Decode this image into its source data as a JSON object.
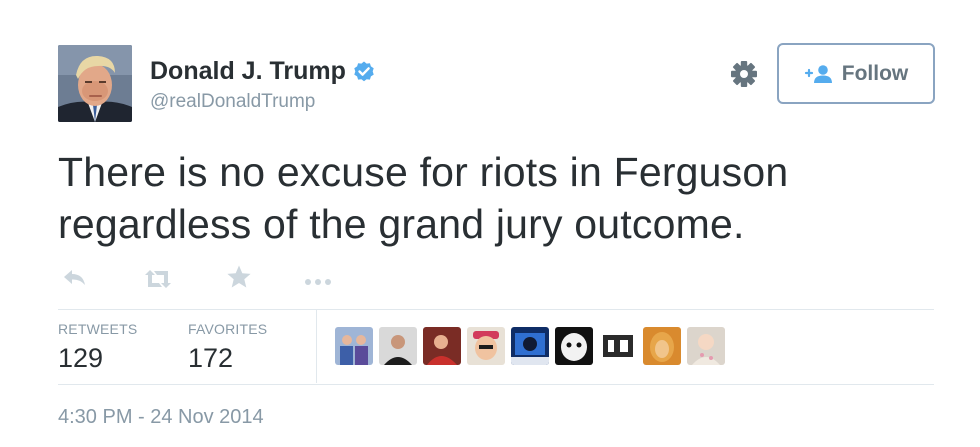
{
  "tweet": {
    "author_name": "Donald J. Trump",
    "handle": "@realDonaldTrump",
    "text_line1": "There is no excuse for riots in Ferguson",
    "text_line2": "regardless of the grand jury outcome.",
    "follow_label": "Follow",
    "timestamp": "4:30 PM - 24 Nov 2014"
  },
  "stats": {
    "retweets_label": "RETWEETS",
    "retweets_value": "129",
    "favorites_label": "FAVORITES",
    "favorites_value": "172"
  },
  "icons": {
    "verified": "verified-badge-icon",
    "settings": "gear-icon",
    "follow": "add-user-icon",
    "reply": "reply-icon",
    "retweet": "retweet-icon",
    "favorite": "star-icon",
    "more": "more-icon"
  },
  "colors": {
    "verified": "#55acee",
    "secondary_text": "#8899a6",
    "follow_border": "#8aa4c1",
    "action_icon": "#ccd6dd"
  },
  "favoriter_avatars": [
    "favoriter-avatar-1",
    "favoriter-avatar-2",
    "favoriter-avatar-3",
    "favoriter-avatar-4",
    "favoriter-avatar-5",
    "favoriter-avatar-6",
    "favoriter-avatar-7",
    "favoriter-avatar-8",
    "favoriter-avatar-9"
  ]
}
